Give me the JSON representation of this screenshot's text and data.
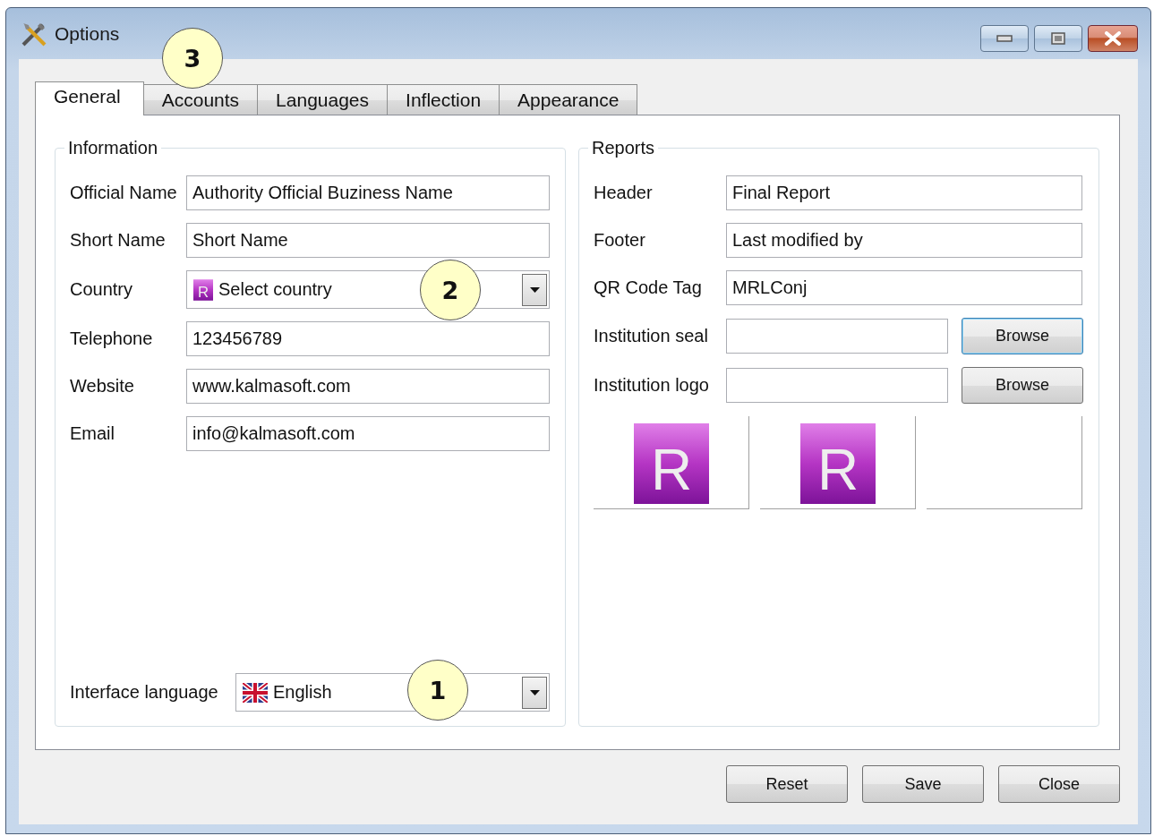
{
  "window": {
    "title": "Options"
  },
  "tabs": [
    {
      "label": "General",
      "selected": true
    },
    {
      "label": "Accounts",
      "selected": false
    },
    {
      "label": "Languages",
      "selected": false
    },
    {
      "label": "Inflection",
      "selected": false
    },
    {
      "label": "Appearance",
      "selected": false
    }
  ],
  "information": {
    "title": "Information",
    "fields": [
      {
        "label": "Official Name",
        "kind": "text",
        "value": "Authority Official Buziness Name"
      },
      {
        "label": "Short Name",
        "kind": "text",
        "value": "Short Name"
      },
      {
        "label": "Country",
        "kind": "select",
        "value": "Select country",
        "icon_letter": "R"
      },
      {
        "label": "Telephone",
        "kind": "text",
        "value": "123456789"
      },
      {
        "label": "Website",
        "kind": "text",
        "value": "www.kalmasoft.com"
      },
      {
        "label": "Email",
        "kind": "text",
        "value": "info@kalmasoft.com"
      }
    ],
    "interface_language": {
      "label": "Interface language",
      "value": "English"
    }
  },
  "reports": {
    "title": "Reports",
    "fields": [
      {
        "label": "Header",
        "kind": "text",
        "value": "Final Report"
      },
      {
        "label": "Footer",
        "kind": "text",
        "value": "Last modified by"
      },
      {
        "label": "QR Code Tag",
        "kind": "text",
        "value": "MRLConj"
      },
      {
        "label": "Institution seal",
        "kind": "file",
        "button": "Browse",
        "focused": true
      },
      {
        "label": "Institution logo",
        "kind": "file",
        "button": "Browse",
        "focused": false
      }
    ],
    "previews": [
      {
        "kind": "logo",
        "letter": "R"
      },
      {
        "kind": "logo",
        "letter": "R"
      },
      {
        "kind": "empty"
      }
    ]
  },
  "buttons": [
    "Reset",
    "Save",
    "Close"
  ],
  "callouts": [
    {
      "label": "3"
    },
    {
      "label": "2"
    },
    {
      "label": "1"
    }
  ]
}
